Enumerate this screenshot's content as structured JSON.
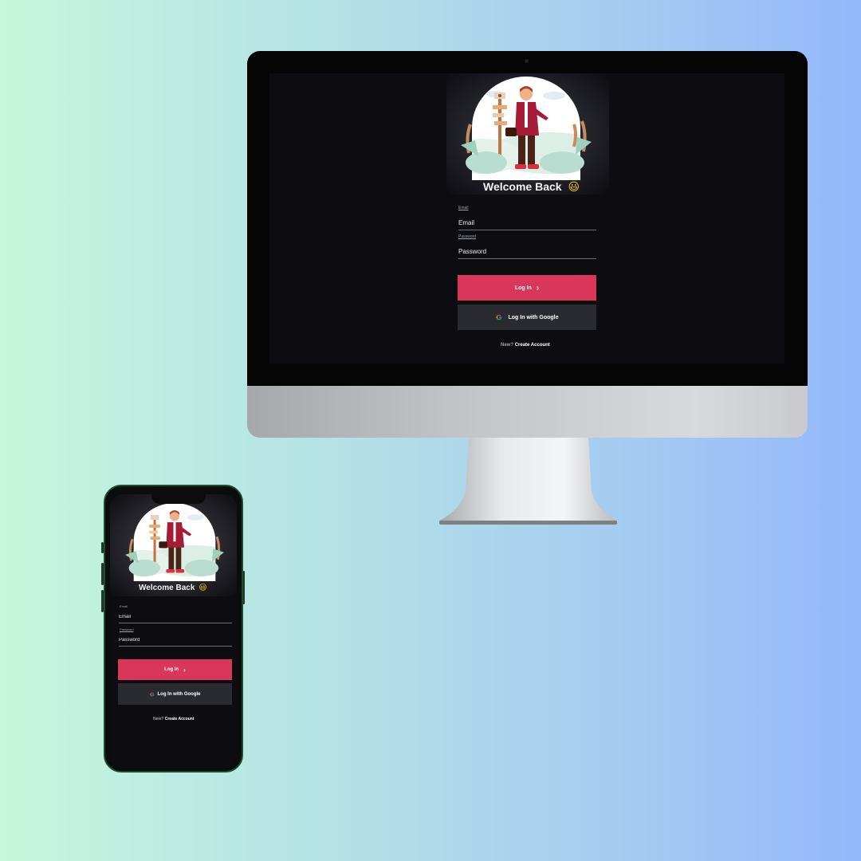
{
  "desktop": {
    "welcome_title": "Welcome Back",
    "welcome_emoji": "😃",
    "email": {
      "label": "Email",
      "placeholder": "Email"
    },
    "password": {
      "label": "Password",
      "placeholder": "Password"
    },
    "login_button": {
      "label": "Log In",
      "chevron": "›"
    },
    "google_button": {
      "label": "Log In with Google",
      "icon": "google-g-icon"
    },
    "footer": {
      "prompt": "New?",
      "link": "Create Account"
    }
  },
  "mobile": {
    "welcome_title": "Welcome Back",
    "welcome_emoji": "😃",
    "email": {
      "label": "Email",
      "placeholder": "Email"
    },
    "password": {
      "label": "Password",
      "placeholder": "Password"
    },
    "login_button": {
      "label": "Log In",
      "chevron": "›"
    },
    "google_button": {
      "label": "Log In with Google",
      "icon": "google-g-icon"
    },
    "footer": {
      "prompt": "New?",
      "link": "Create Account"
    }
  },
  "colors": {
    "background_gradient": [
      "#c5f7dc",
      "#93b8fb"
    ],
    "screen_bg": "#0c0c11",
    "accent": "#d9375a",
    "secondary_button": "#2a2b30"
  }
}
